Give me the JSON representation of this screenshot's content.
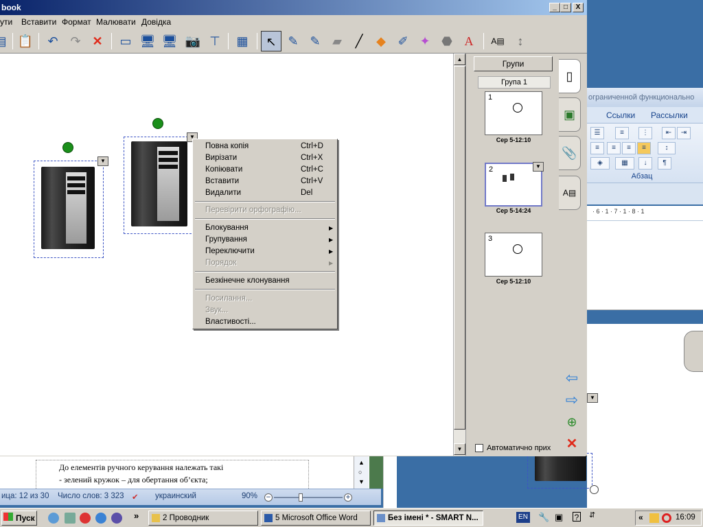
{
  "notebook": {
    "title": "book",
    "window_controls": {
      "minimize": "_",
      "maximize": "□",
      "close": "X"
    },
    "menu": [
      "ути",
      "Вставити",
      "Формат",
      "Малювати",
      "Довідка"
    ]
  },
  "context_menu": {
    "items": [
      {
        "label": "Повна копія",
        "shortcut": "Ctrl+D",
        "disabled": false
      },
      {
        "label": " Вирізати",
        "shortcut": "Ctrl+X",
        "disabled": false
      },
      {
        "label": "Копіювати",
        "shortcut": "Ctrl+C",
        "disabled": false
      },
      {
        "label": "Вставити",
        "shortcut": "Ctrl+V",
        "disabled": false
      },
      {
        "label": "Видалити",
        "shortcut": "Del",
        "disabled": false
      },
      {
        "label": "Перевірити орфографію...",
        "shortcut": "",
        "disabled": true
      },
      {
        "label": "Блокування",
        "shortcut": "",
        "disabled": false,
        "submenu": true
      },
      {
        "label": "Групування",
        "shortcut": "",
        "disabled": false,
        "submenu": true
      },
      {
        "label": "Переключити",
        "shortcut": "",
        "disabled": false,
        "submenu": true
      },
      {
        "label": "Порядок",
        "shortcut": "",
        "disabled": true,
        "submenu": true
      },
      {
        "label": "Безкінечне клонування",
        "shortcut": "",
        "disabled": false
      },
      {
        "label": "Посилання...",
        "shortcut": "",
        "disabled": true
      },
      {
        "label": "Звук...",
        "shortcut": "",
        "disabled": true
      },
      {
        "label": "Властивості...",
        "shortcut": "",
        "disabled": false
      }
    ]
  },
  "page_sorter": {
    "groups_button": "Групи",
    "group_label": "Група 1",
    "pages": [
      {
        "number": "1",
        "timestamp": "Сер 5-12:10"
      },
      {
        "number": "2",
        "timestamp": "Сер 5-14:24"
      },
      {
        "number": "3",
        "timestamp": "Сер 5-12:10"
      }
    ],
    "auto_hide_label": "Автоматично прих"
  },
  "word": {
    "title_fragment": "ограниченной функционально",
    "ribbon_tabs": [
      "Ссылки",
      "Рассылки"
    ],
    "paragraph_group": "Абзац",
    "ruler": "· 6 · 1 · 7 · 1 · 8 · 1",
    "doc_lines": [
      "До елементів ручного керування належать такі",
      "- зелений кружок – для обертання об’єкта;"
    ],
    "status": {
      "page": "ица: 12 из 30",
      "words": "Число слов: 3 323",
      "language": "украинский",
      "zoom": "90%"
    }
  },
  "taskbar": {
    "start": "Пуск",
    "tasks": [
      {
        "label": "2 Проводник",
        "active": false
      },
      {
        "label": "5 Microsoft Office Word",
        "active": false
      },
      {
        "label": "Без імені * - SMART N...",
        "active": true
      }
    ],
    "language": "EN",
    "clock": "16:09",
    "chevron": "»",
    "tray_chevron": "«"
  },
  "colors": {
    "title_gradient_start": "#0a246a",
    "rotation_handle": "#1a8f1a",
    "selection_border": "#3b53c4",
    "delete_red": "#e02a1a",
    "nav_blue": "#2f7fd6"
  }
}
